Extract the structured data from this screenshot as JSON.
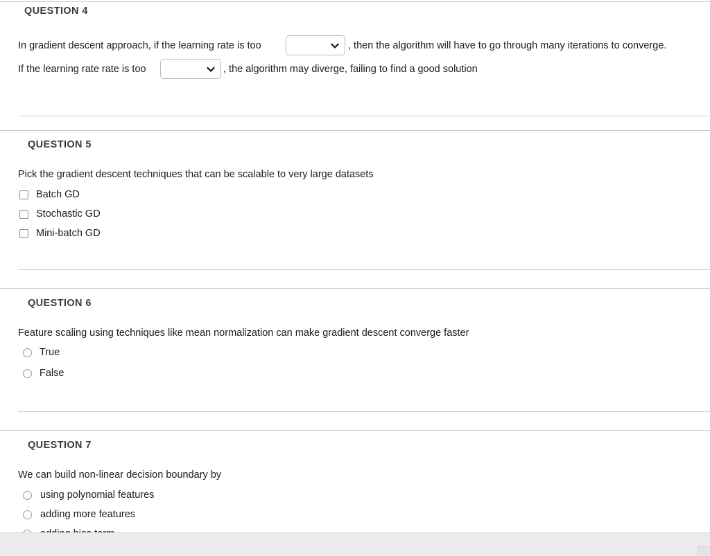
{
  "questions": [
    {
      "heading": "QUESTION 4",
      "type": "dropdown-fill-in",
      "lines": [
        {
          "before": "In gradient descent approach, if the learning rate is too",
          "after": ", then the algorithm will have to go through many iterations to converge."
        },
        {
          "before": "If the learning rate rate is too",
          "after": ", the algorithm may diverge, failing to find a good solution"
        }
      ],
      "dropdowns": [
        {
          "value": "",
          "placeholder": ""
        },
        {
          "value": "",
          "placeholder": ""
        }
      ]
    },
    {
      "heading": "QUESTION 5",
      "type": "checkbox",
      "prompt": "Pick the gradient descent techniques that can be scalable to very large datasets",
      "options": [
        {
          "label": "Batch GD",
          "checked": false
        },
        {
          "label": "Stochastic GD",
          "checked": false
        },
        {
          "label": "Mini-batch GD",
          "checked": false
        }
      ]
    },
    {
      "heading": "QUESTION 6",
      "type": "radio",
      "prompt": "Feature scaling using techniques like mean normalization can make gradient descent converge faster",
      "options": [
        {
          "label": "True",
          "selected": false
        },
        {
          "label": "False",
          "selected": false
        }
      ]
    },
    {
      "heading": "QUESTION 7",
      "type": "radio",
      "prompt": "We can build non-linear decision boundary by",
      "options": [
        {
          "label": "using polynomial features",
          "selected": false
        },
        {
          "label": "adding more features",
          "selected": false
        },
        {
          "label": "adding bias term",
          "selected": false
        }
      ]
    }
  ],
  "icons": {
    "chevron_down": "chevron-down-icon"
  },
  "colors": {
    "text": "#1b1b1b",
    "heading": "#3b3b3b",
    "rule": "#c9c9c9",
    "control_border": "#bdbdbd",
    "footer": "#ececec"
  }
}
